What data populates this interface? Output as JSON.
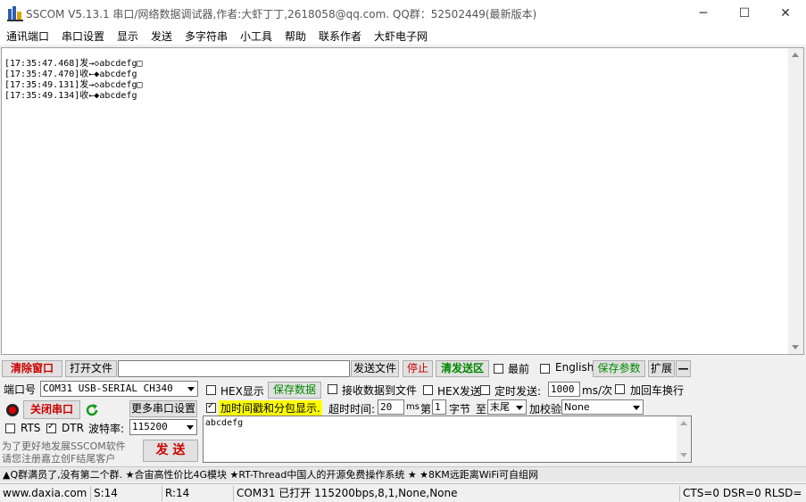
{
  "window": {
    "title": "SSCOM V5.13.1 串口/网络数据调试器,作者:大虾丁丁,2618058@qq.com. QQ群：52502449(最新版本)",
    "minimize": "─",
    "maximize": "☐",
    "close": "✕"
  },
  "menu": [
    "通讯端口",
    "串口设置",
    "显示",
    "发送",
    "多字符串",
    "小工具",
    "帮助",
    "联系作者",
    "大虾电子网"
  ],
  "console": {
    "lines": [
      "[17:35:47.468]发→◇abcdefg□",
      "[17:35:47.470]收←◆abcdefg",
      "[17:35:49.131]发→◇abcdefg□",
      "[17:35:49.134]收←◆abcdefg"
    ]
  },
  "toolbar": {
    "clear_window": "清除窗口",
    "open_file": "打开文件",
    "send_file": "发送文件",
    "stop": "停止",
    "clear_send": "清发送区",
    "topmost": "最前",
    "english": "English",
    "save_params": "保存参数",
    "expand": "扩展",
    "collapse": "—"
  },
  "port": {
    "label": "端口号",
    "value": "COM31 USB-SERIAL CH340",
    "close_port": "关闭串口",
    "more_settings": "更多串口设置",
    "rts": "RTS",
    "dtr": "DTR",
    "baud_label": "波特率:",
    "baud_value": "115200"
  },
  "options": {
    "hex_display": "HEX显示",
    "save_data": "保存数据",
    "recv_to_file": "接收数据到文件",
    "hex_send": "HEX发送",
    "timed_send": "定时发送:",
    "interval": "1000",
    "interval_unit": "ms/次",
    "add_crlf": "加回车换行",
    "timestamp": "加时间戳和分包显示.",
    "timeout_label": "超时时间:",
    "timeout_value": "20",
    "timeout_unit": "ms",
    "byte_prefix": "第",
    "byte_index": "1",
    "byte_unit": "字节",
    "to_label": "至",
    "end_value": "末尾",
    "checksum_label": "加校验",
    "checksum_value": "None"
  },
  "send": {
    "text": "abcdefg",
    "button": "发 送",
    "promo_line1": "为了更好地发展SSCOM软件",
    "promo_line2": "请您注册嘉立创F结尾客户"
  },
  "ticker": "▲Q群满员了,没有第二个群. ★合宙高性价比4G模块 ★RT-Thread中国人的开源免费操作系统 ★ ★8KM远距离WiFi可自组网",
  "status": {
    "site": "www.daxia.com",
    "sent": "S:14",
    "received": "R:14",
    "port_state": "COM31 已打开  115200bps,8,1,None,None",
    "lines": "CTS=0 DSR=0 RLSD="
  }
}
